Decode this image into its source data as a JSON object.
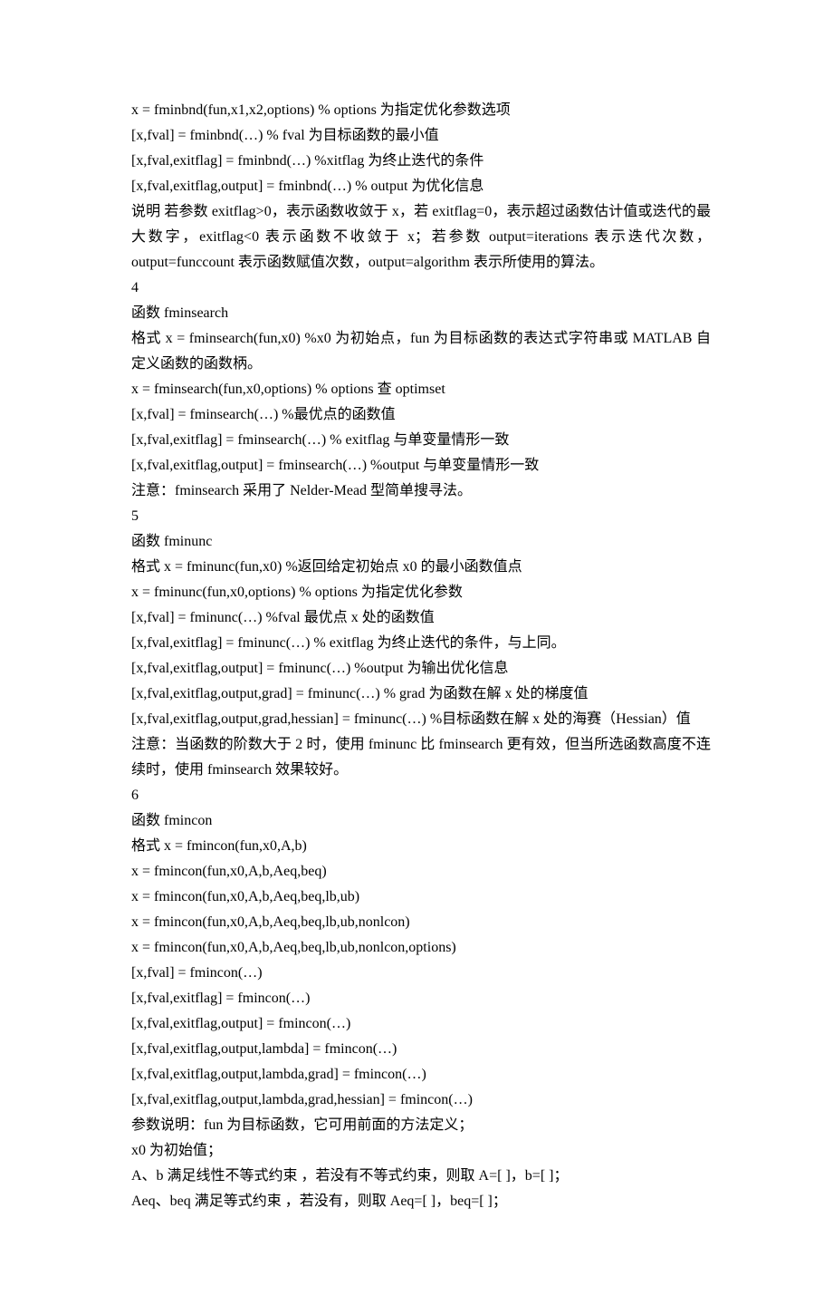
{
  "lines": [
    "x = fminbnd(fun,x1,x2,options)      % options 为指定优化参数选项",
    "[x,fval] = fminbnd(…)      % fval 为目标函数的最小值",
    "[x,fval,exitflag] = fminbnd(…)      %xitflag 为终止迭代的条件",
    "[x,fval,exitflag,output] = fminbnd(…)        % output 为优化信息",
    "说明   若参数 exitflag>0，表示函数收敛于 x，若 exitflag=0，表示超过函数估计值或迭代的最大数字，exitflag<0 表示函数不收敛于 x；若参数 output=iterations 表示迭代次数，output=funccount 表示函数赋值次数，output=algorithm 表示所使用的算法。",
    "4",
    "函数    fminsearch",
    "格式   x = fminsearch(fun,x0)       %x0 为初始点，fun 为目标函数的表达式字符串或 MATLAB 自定义函数的函数柄。",
    "x = fminsearch(fun,x0,options)      % options 查 optimset",
    "[x,fval] = fminsearch(…)      %最优点的函数值",
    "[x,fval,exitflag] = fminsearch(…)      % exitflag 与单变量情形一致",
    "[x,fval,exitflag,output] = fminsearch(…)     %output 与单变量情形一致",
    "注意：fminsearch 采用了 Nelder-Mead 型简单搜寻法。",
    "5",
    "函数    fminunc",
    "格式   x = fminunc(fun,x0)      %返回给定初始点 x0 的最小函数值点",
    "x = fminunc(fun,x0,options)      % options 为指定优化参数",
    "[x,fval] = fminunc(…)      %fval 最优点 x 处的函数值",
    "[x,fval,exitflag] = fminunc(…)      % exitflag 为终止迭代的条件，与上同。",
    "[x,fval,exitflag,output] = fminunc(…)       %output 为输出优化信息",
    "[x,fval,exitflag,output,grad] = fminunc(…)       % grad 为函数在解 x 处的梯度值",
    "[x,fval,exitflag,output,grad,hessian] = fminunc(…)       %目标函数在解 x 处的海赛（Hessian）值",
    "注意：当函数的阶数大于 2 时，使用 fminunc 比 fminsearch 更有效，但当所选函数高度不连续时，使用 fminsearch 效果较好。",
    "6",
    "函数    fmincon",
    "格式   x = fmincon(fun,x0,A,b)",
    "x = fmincon(fun,x0,A,b,Aeq,beq)",
    "x = fmincon(fun,x0,A,b,Aeq,beq,lb,ub)",
    "x = fmincon(fun,x0,A,b,Aeq,beq,lb,ub,nonlcon)",
    "x = fmincon(fun,x0,A,b,Aeq,beq,lb,ub,nonlcon,options)",
    "[x,fval] = fmincon(…)",
    "[x,fval,exitflag] = fmincon(…)",
    "[x,fval,exitflag,output] = fmincon(…)",
    "[x,fval,exitflag,output,lambda] = fmincon(…)",
    "[x,fval,exitflag,output,lambda,grad] = fmincon(…)",
    "[x,fval,exitflag,output,lambda,grad,hessian] = fmincon(…)",
    "参数说明：fun 为目标函数，它可用前面的方法定义；",
    "x0 为初始值；",
    "A、b 满足线性不等式约束 ，若没有不等式约束，则取 A=[ ]，b=[ ]；",
    "Aeq、beq 满足等式约束 ，若没有，则取 Aeq=[ ]，beq=[ ]；"
  ]
}
